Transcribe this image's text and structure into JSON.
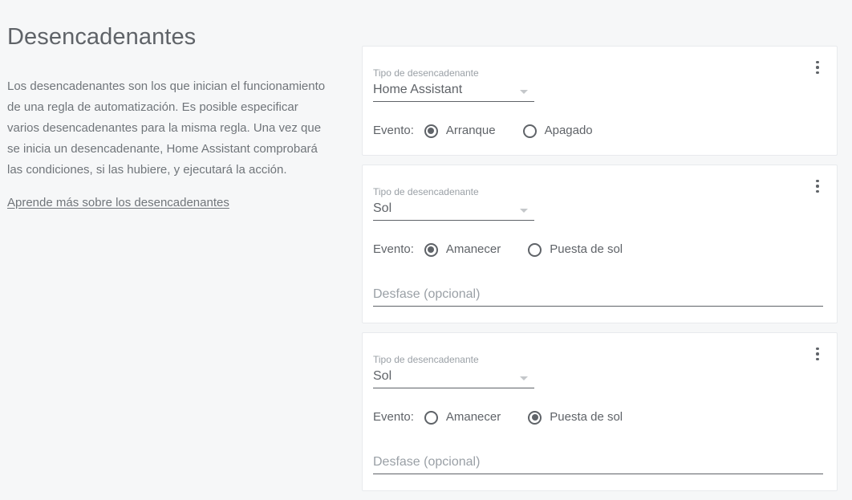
{
  "page": {
    "title": "Desencadenantes",
    "intro_paragraph": "Los desencadenantes son los que inician el funcionamiento de una regla de automatización. Es posible especificar varios desencadenantes para la misma regla. Una vez que se inicia un desencadenante, Home Assistant comprobará las condiciones, si las hubiere, y ejecutará la acción.",
    "learn_more_link": "Aprende más sobre los desencadenantes",
    "background_color": "#f6f7f8",
    "text_color": "#70757a",
    "title_color": "#5f6368"
  },
  "common": {
    "trigger_type_label": "Tipo de desencadenante",
    "event_label": "Evento:",
    "offset_placeholder": "Desfase (opcional)",
    "menu_icon": "kebab-menu-icon",
    "caret_icon": "chevron-down-icon"
  },
  "cards": [
    {
      "trigger_type_label": "Tipo de desencadenante",
      "trigger_type_value": "Home Assistant",
      "event_label": "Evento:",
      "options": [
        {
          "label": "Arranque",
          "selected": true
        },
        {
          "label": "Apagado",
          "selected": false
        }
      ],
      "has_offset": false
    },
    {
      "trigger_type_label": "Tipo de desencadenante",
      "trigger_type_value": "Sol",
      "event_label": "Evento:",
      "options": [
        {
          "label": "Amanecer",
          "selected": true
        },
        {
          "label": "Puesta de sol",
          "selected": false
        }
      ],
      "has_offset": true,
      "offset_placeholder": "Desfase (opcional)",
      "offset_value": ""
    },
    {
      "trigger_type_label": "Tipo de desencadenante",
      "trigger_type_value": "Sol",
      "event_label": "Evento:",
      "options": [
        {
          "label": "Amanecer",
          "selected": false
        },
        {
          "label": "Puesta de sol",
          "selected": true
        }
      ],
      "has_offset": true,
      "offset_placeholder": "Desfase (opcional)",
      "offset_value": ""
    }
  ]
}
